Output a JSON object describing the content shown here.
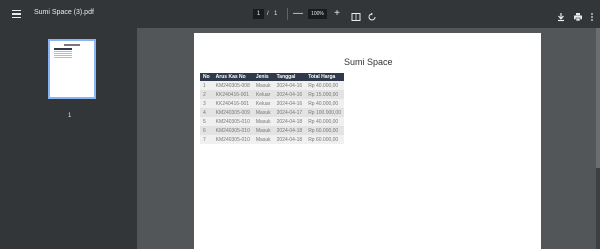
{
  "window": {
    "file_name": "Sumi Space (3).pdf"
  },
  "toolbar": {
    "current_page": "1",
    "page_separator": "/",
    "total_pages": "1",
    "zoom_out_label": "—",
    "zoom_level": "100%",
    "zoom_in_label": "+"
  },
  "icons": {
    "menu": "hamburger-menu-icon",
    "fit": "fit-to-page-icon",
    "rotate": "rotate-icon",
    "download": "download-icon",
    "print": "print-icon",
    "more": "more-vertical-icon"
  },
  "sidebar": {
    "thumbnail_page_number": "1"
  },
  "document": {
    "title": "Sumi Space",
    "columns": [
      "No",
      "Arus Kas No",
      "Jenis",
      "Tanggal",
      "Total Harga"
    ],
    "rows": [
      [
        "1",
        "KM240305-008",
        "Masuk",
        "2024-04-16",
        "Rp 40.000,00"
      ],
      [
        "2",
        "KK240416-001",
        "Keluar",
        "2024-04-16",
        "Rp 15.000,00"
      ],
      [
        "3",
        "KK240416-001",
        "Keluar",
        "2024-04-16",
        "Rp 40.000,00"
      ],
      [
        "4",
        "KM240305-009",
        "Masuk",
        "2024-04-17",
        "Rp 100.000,00"
      ],
      [
        "5",
        "KM240305-010",
        "Masuk",
        "2024-04-18",
        "Rp 40.000,00"
      ],
      [
        "6",
        "KM240305-010",
        "Masuk",
        "2024-04-18",
        "Rp 60.000,00"
      ],
      [
        "7",
        "KM240305-010",
        "Masuk",
        "2024-04-18",
        "Rp 60.000,00"
      ]
    ]
  },
  "colors": {
    "toolbar_bg": "#323639",
    "viewer_bg": "#525659",
    "table_header_bg": "#2f3a4a",
    "thumbnail_border": "#8ab4f8"
  }
}
